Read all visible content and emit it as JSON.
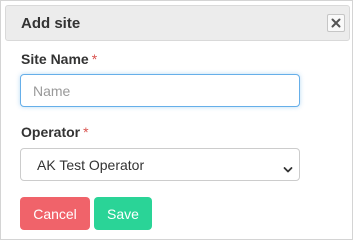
{
  "dialog": {
    "title": "Add site",
    "close_icon": "close-x-icon"
  },
  "form": {
    "site_name": {
      "label": "Site Name",
      "required_mark": "*",
      "value": "",
      "placeholder": "Name"
    },
    "operator": {
      "label": "Operator",
      "required_mark": "*",
      "selected": "AK Test Operator",
      "chevron_icon": "chevron-down-icon"
    }
  },
  "buttons": {
    "cancel_label": "Cancel",
    "save_label": "Save"
  },
  "colors": {
    "required": "#d9534f",
    "cancel": "#f0636a",
    "save": "#2ad497",
    "focus_border": "#66afe9",
    "header_bg": "#ececec"
  }
}
